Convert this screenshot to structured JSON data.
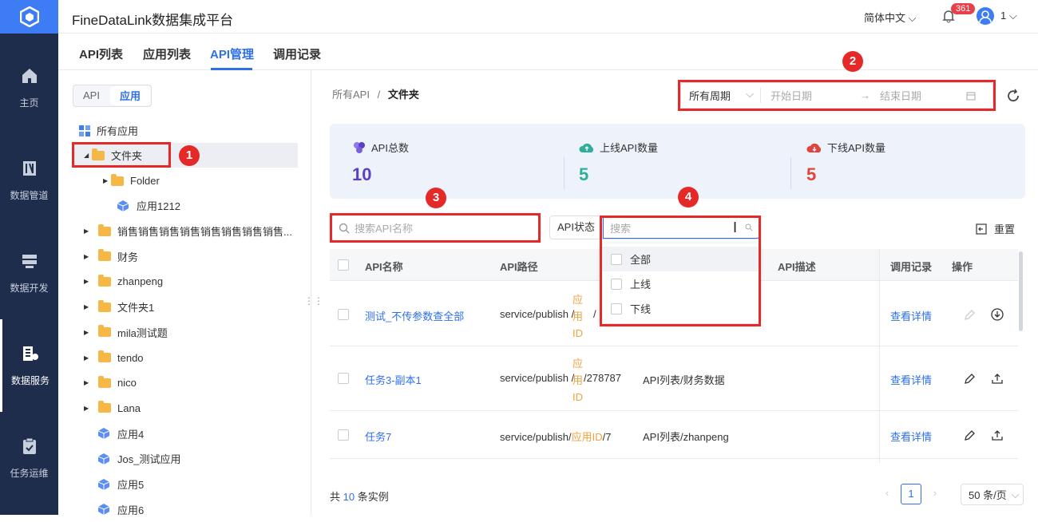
{
  "app": {
    "title": "FineDataLink数据集成平台"
  },
  "header": {
    "language": "简体中文",
    "notification_count": "361",
    "user": "1"
  },
  "sidebar": {
    "items": [
      {
        "label": "主页",
        "icon": "home-icon"
      },
      {
        "label": "数据管道",
        "icon": "pipeline-icon"
      },
      {
        "label": "数据开发",
        "icon": "dev-icon"
      },
      {
        "label": "数据服务",
        "icon": "service-icon",
        "active": true
      },
      {
        "label": "任务运维",
        "icon": "ops-icon"
      }
    ]
  },
  "tabs": [
    {
      "label": "API列表"
    },
    {
      "label": "应用列表"
    },
    {
      "label": "API管理",
      "active": true
    },
    {
      "label": "调用记录"
    }
  ],
  "tree": {
    "segment": [
      "API",
      "应用"
    ],
    "root": "所有应用",
    "items": [
      "文件夹",
      "Folder",
      "应用1212",
      "销售销售销售销售销售销售销售销售...",
      "财务",
      "zhanpeng",
      "文件夹1",
      "mila测试题",
      "tendo",
      "nico",
      "Lana",
      "应用4",
      "Jos_测试应用",
      "应用5",
      "应用6"
    ]
  },
  "breadcrumb": {
    "root": "所有API",
    "sep": "/",
    "current": "文件夹"
  },
  "filter": {
    "period": "所有周期",
    "start_placeholder": "开始日期",
    "end_placeholder": "结束日期"
  },
  "stats": [
    {
      "label": "API总数",
      "value": "10",
      "color": "#5b3fc4"
    },
    {
      "label": "上线API数量",
      "value": "5",
      "color": "#2fae9c"
    },
    {
      "label": "下线API数量",
      "value": "5",
      "color": "#e0443c"
    }
  ],
  "search": {
    "placeholder": "搜索API名称"
  },
  "api_status": {
    "label": "API状态",
    "placeholder": "搜索",
    "options": [
      "全部",
      "上线",
      "下线"
    ]
  },
  "reset_label": "重置",
  "table": {
    "columns": [
      "API名称",
      "API路径",
      "API描述",
      "调用记录",
      "操作"
    ],
    "rows": [
      {
        "name": "测试_不传参数查全部",
        "path_prefix": "service/publish",
        "path_app": "应用ID",
        "path_id": "/",
        "desc": "",
        "action": "查看详情"
      },
      {
        "name": "任务3-副本1",
        "path_prefix": "service/publish",
        "path_app": "应用ID",
        "path_id": "278787",
        "desc": "API列表/财务数据",
        "action": "查看详情"
      },
      {
        "name": "任务7",
        "path_prefix": "service/publish",
        "path_app": "应用ID",
        "path_id": "7",
        "desc": "API列表/zhanpeng",
        "action": "查看详情"
      }
    ]
  },
  "footer": {
    "total_prefix": "共",
    "total": "10",
    "total_suffix": "条实例",
    "page": "1",
    "page_size": "50 条/页"
  },
  "annotations": [
    "1",
    "2",
    "3",
    "4"
  ]
}
